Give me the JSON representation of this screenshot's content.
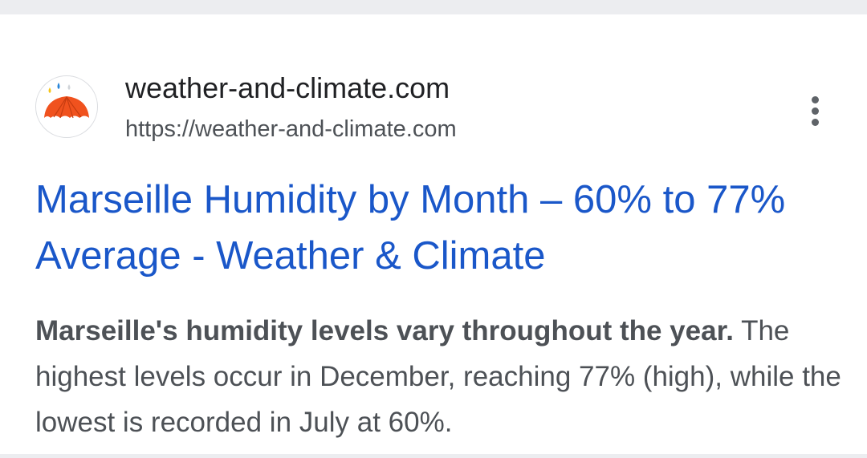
{
  "result": {
    "site_name": "weather-and-climate.com",
    "site_url": "https://weather-and-climate.com",
    "title": "Marseille Humidity by Month – 60% to 77% Average - Weather & Climate",
    "snippet_bold": "Marseille's humidity levels vary throughout the year.",
    "snippet_rest": " The highest levels occur in December, reaching 77% (high), while the lowest is recorded in July at 60%.",
    "favicon": "umbrella-icon",
    "more_icon": "more-vert-icon"
  },
  "colors": {
    "title_link": "#1a57c9",
    "favicon_orange": "#f0521e",
    "favicon_blue": "#2a86d8",
    "favicon_yellow": "#f5c518"
  }
}
